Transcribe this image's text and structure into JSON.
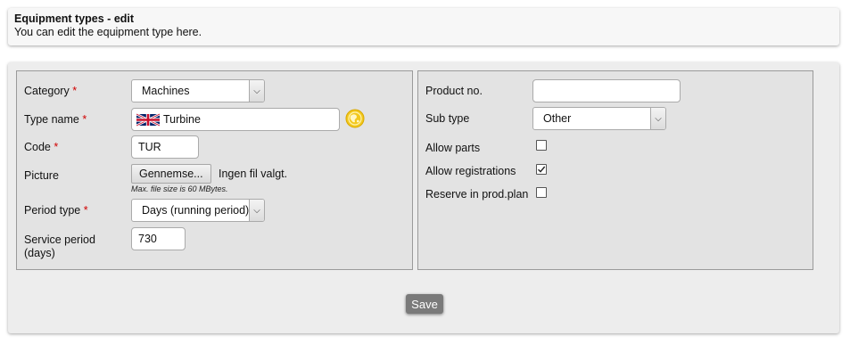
{
  "header": {
    "title": "Equipment types - edit",
    "subtitle": "You can edit the equipment type here."
  },
  "form": {
    "required_marker": "*",
    "category": {
      "label": "Category",
      "value": "Machines"
    },
    "type_name": {
      "label": "Type name",
      "value": "Turbine",
      "flag": "uk-flag-icon"
    },
    "code": {
      "label": "Code",
      "value": "TUR"
    },
    "picture": {
      "label": "Picture",
      "button": "Gennemse...",
      "status": "Ingen fil valgt.",
      "note": "Max. file size is 60 MBytes."
    },
    "period_type": {
      "label": "Period type",
      "value": "Days (running period)"
    },
    "service_period": {
      "label_line1": "Service period",
      "label_line2": "(days)",
      "value": "730"
    },
    "product_no": {
      "label": "Product no.",
      "value": ""
    },
    "sub_type": {
      "label": "Sub type",
      "value": "Other"
    },
    "allow_parts": {
      "label": "Allow parts",
      "checked": false
    },
    "allow_registrations": {
      "label": "Allow registrations",
      "checked": true
    },
    "reserve_prod_plan": {
      "label": "Reserve in prod.plan",
      "checked": false
    }
  },
  "actions": {
    "save_label": "Save"
  },
  "colors": {
    "required": "#d00000",
    "save_button": "#7a7a7a",
    "globe": "#f2c81e"
  }
}
